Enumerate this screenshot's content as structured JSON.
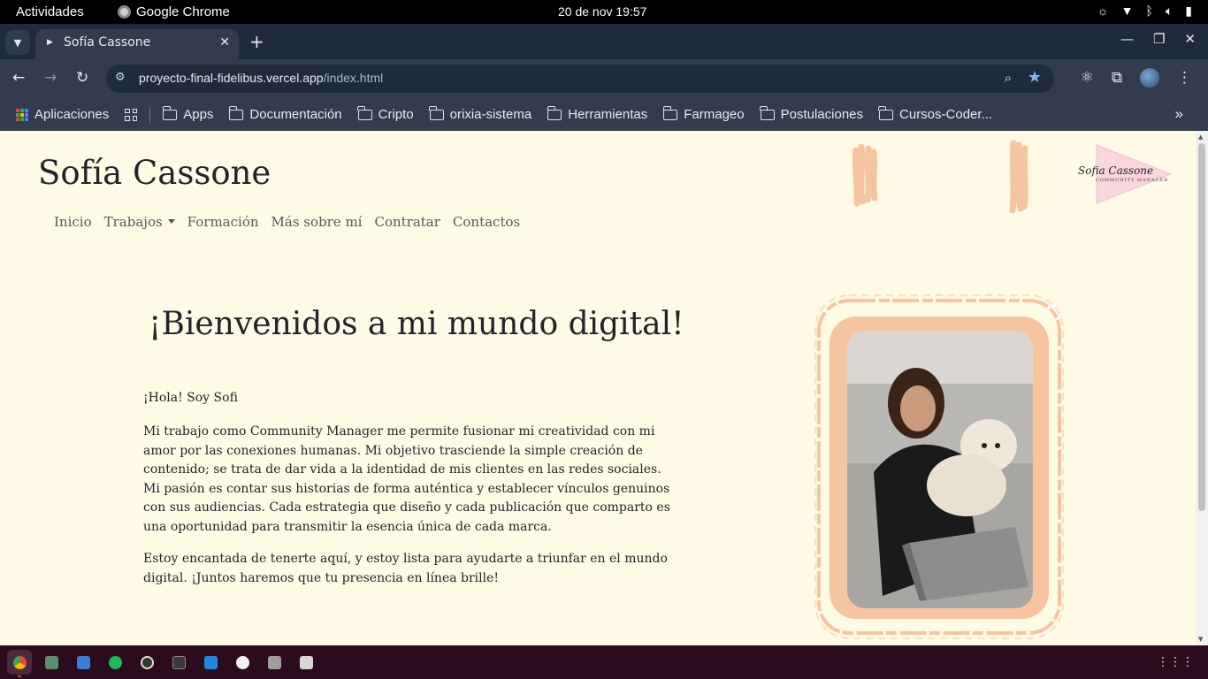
{
  "system": {
    "activities": "Actividades",
    "app_name": "Google Chrome",
    "clock": "20 de nov  19:57"
  },
  "browser": {
    "tab_title": "Sofía Cassone",
    "url_host": "proyecto-final-fidelibus.vercel.app",
    "url_path": "/index.html",
    "bookmarks": {
      "apps_label": "Aplicaciones",
      "folders": [
        "Apps",
        "Documentación",
        "Cripto",
        "orixia-sistema",
        "Herramientas",
        "Farmageo",
        "Postulaciones",
        "Cursos-Coder..."
      ]
    }
  },
  "site": {
    "brand": "Sofía Cassone",
    "logo_text": "Sofia Cassone",
    "logo_subtitle": "COMMUNITY MANAGER",
    "nav": [
      "Inicio",
      "Trabajos",
      "Formación",
      "Más sobre mí",
      "Contratar",
      "Contactos"
    ],
    "hero_title": "¡Bienvenidos a mi mundo digital!",
    "greeting": "¡Hola! Soy Sofi",
    "paragraph1": "Mi trabajo como Community Manager me permite fusionar mi creatividad con mi amor por las conexiones humanas. Mi objetivo trasciende la simple creación de contenido; se trata de dar vida a la identidad de mis clientes en las redes sociales. Mi pasión es contar sus historias de forma auténtica y establecer vínculos genuinos con sus audiencias. Cada estrategia que diseño y cada publicación que comparto es una oportunidad para transmitir la esencia única de cada marca.",
    "paragraph2": "Estoy encantada de tenerte aquí, y estoy lista para ayudarte a triunfar en el mundo digital. ¡Juntos haremos que tu presencia en línea brille!"
  },
  "colors": {
    "page_bg": "#fffae6",
    "accent_peach": "#f7c4a0",
    "chrome_dark": "#1f2a3a",
    "dock_bg": "#2b0b1e"
  }
}
